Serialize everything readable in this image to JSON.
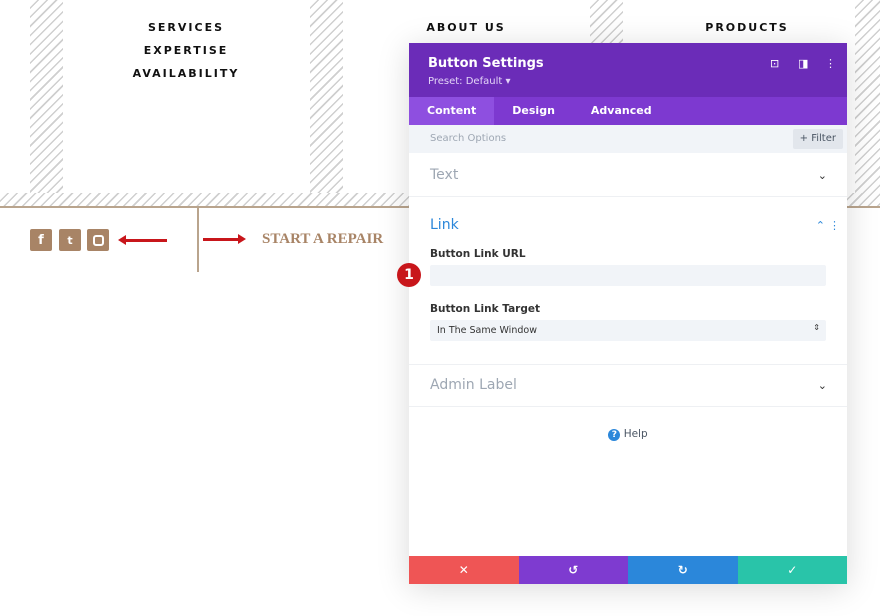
{
  "nav": {
    "col1": [
      "SERVICES",
      "EXPERTISE",
      "AVAILABILITY"
    ],
    "col2": "ABOUT US",
    "col3": "PRODUCTS"
  },
  "social": {
    "icons": [
      "facebook-icon",
      "twitter-icon",
      "instagram-icon"
    ],
    "color": "#a88466"
  },
  "cta": {
    "label": "START A REPAIR"
  },
  "modal": {
    "title": "Button Settings",
    "preset": "Preset: Default ▾",
    "tabs": [
      "Content",
      "Design",
      "Advanced"
    ],
    "search_placeholder": "Search Options",
    "filter": "+ Filter",
    "sections": {
      "text": "Text",
      "link": "Link",
      "admin": "Admin Label"
    },
    "link_url_label": "Button Link URL",
    "link_url_value": "",
    "link_target_label": "Button Link Target",
    "link_target_value": "In The Same Window",
    "help": "Help",
    "badge": "1",
    "colors": {
      "header": "#6b2cb8",
      "tabs": "#7d39d0",
      "cancel": "#ef5555",
      "undo": "#7e3bd0",
      "redo": "#2b87da",
      "save": "#29c4a9"
    }
  }
}
